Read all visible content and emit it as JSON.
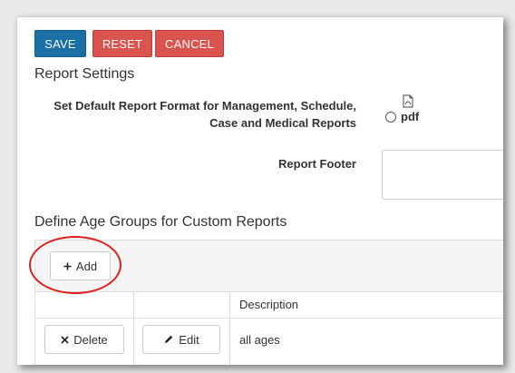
{
  "toolbar": {
    "save_label": "SAVE",
    "reset_label": "RESET",
    "cancel_label": "CANCEL"
  },
  "report_settings": {
    "title": "Report Settings",
    "format_label_line1": "Set Default Report Format for Management, Schedule,",
    "format_label_line2": "Case and Medical Reports",
    "format_option": "pdf",
    "format_icon": "pdf-file-icon",
    "footer_label": "Report Footer",
    "footer_value": ""
  },
  "age_groups": {
    "title": "Define Age Groups for Custom Reports",
    "add_label": "Add",
    "columns": [
      "",
      "",
      "Description"
    ],
    "rows": [
      {
        "delete_label": "Delete",
        "edit_label": "Edit",
        "description": "all ages"
      }
    ]
  },
  "colors": {
    "primary": "#1a6fa6",
    "danger": "#d9534f",
    "highlight_circle": "#e01f1f"
  }
}
